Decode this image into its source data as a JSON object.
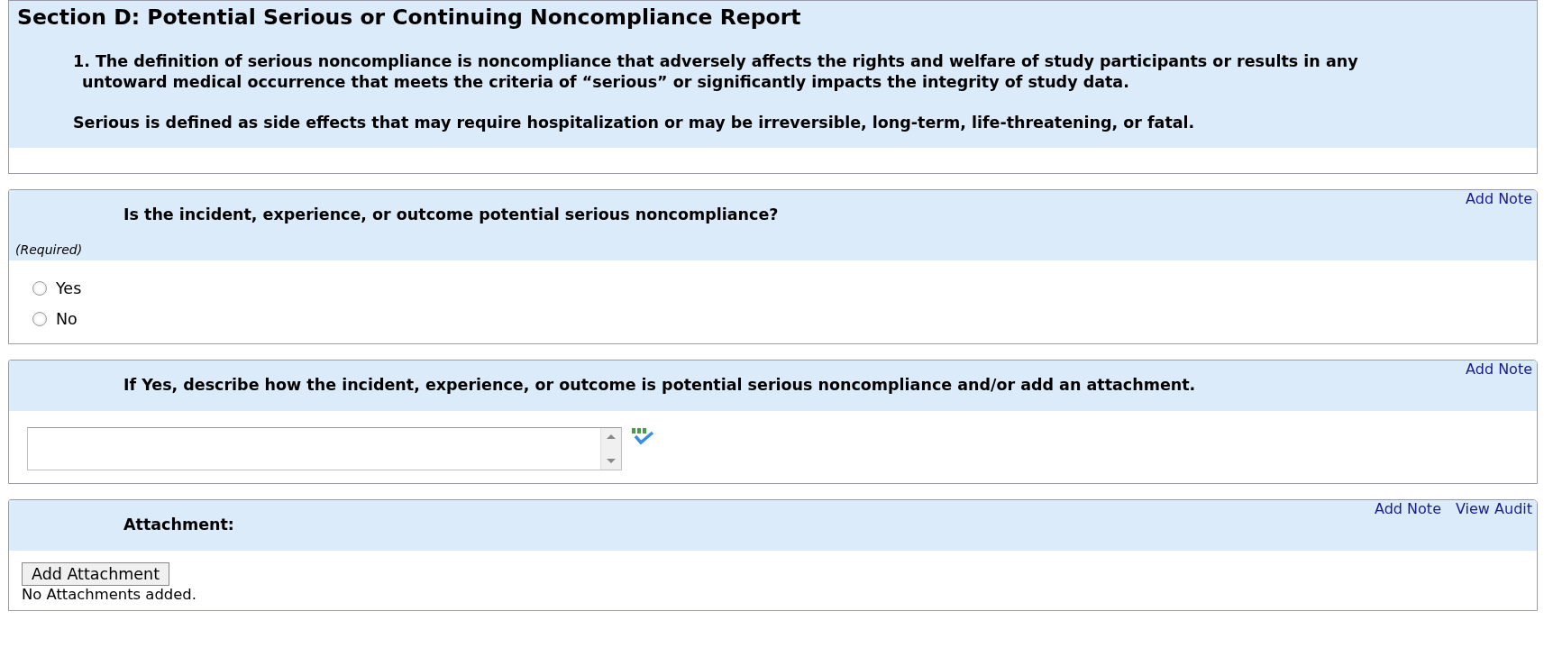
{
  "section": {
    "title": "Section D: Potential Serious or Continuing Noncompliance Report",
    "paragraphs": [
      "1. The definition of serious noncompliance is noncompliance that adversely affects the rights and welfare of study participants or results in any untoward medical occurrence that meets the criteria of “serious” or significantly impacts the integrity of study data.",
      "Serious is defined as side effects that may require hospitalization or may be irreversible, long-term, life-threatening, or fatal."
    ]
  },
  "questions": [
    {
      "kind": "radio",
      "prompt": "Is the incident, experience, or outcome potential serious noncompliance?",
      "required_label": "(Required)",
      "links": [
        "Add Note"
      ],
      "options": [
        {
          "label": "Yes",
          "selected": false
        },
        {
          "label": "No",
          "selected": false
        }
      ]
    },
    {
      "kind": "textarea",
      "prompt": "If Yes, describe how the incident, experience, or outcome is potential serious noncompliance and/or add an attachment.",
      "links": [
        "Add Note"
      ]
    },
    {
      "kind": "attachment",
      "prompt": "Attachment:",
      "links": [
        "Add Note",
        "View Audit"
      ],
      "button": "Add Attachment",
      "status": "No Attachments added."
    }
  ]
}
